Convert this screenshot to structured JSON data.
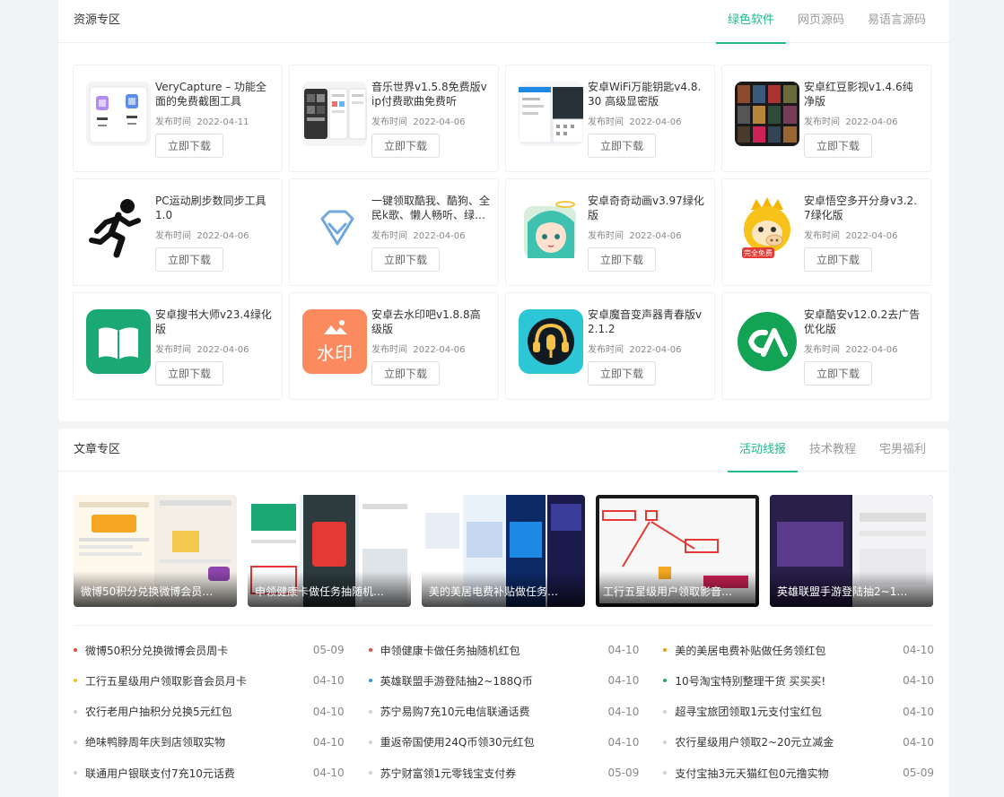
{
  "resources": {
    "title": "资源专区",
    "tabs": [
      {
        "label": "绿色软件",
        "active": true
      },
      {
        "label": "网页源码",
        "active": false
      },
      {
        "label": "易语言源码",
        "active": false
      }
    ],
    "download_label": "立即下载",
    "date_prefix": "发布时间",
    "items": [
      {
        "title": "VeryCapture – 功能全面的免费截图工具",
        "date": "2022-04-11",
        "icon": "verycapture-icon"
      },
      {
        "title": "音乐世界v1.5.8免费版vip付费歌曲免费听",
        "date": "2022-04-06",
        "icon": "music-world-icon"
      },
      {
        "title": "安卓WiFi万能钥匙v4.8.30 高级显密版",
        "date": "2022-04-06",
        "icon": "wifi-key-icon"
      },
      {
        "title": "安卓红豆影视v1.4.6纯净版",
        "date": "2022-04-06",
        "icon": "hongdou-video-icon"
      },
      {
        "title": "PC运动刷步数同步工具1.0",
        "date": "2022-04-06",
        "icon": "running-man-icon"
      },
      {
        "title": "一键领取酷我、酷狗、全民k歌、懒人畅听、绿…",
        "date": "2022-04-06",
        "icon": "diamond-icon"
      },
      {
        "title": "安卓奇奇动画v3.97绿化版",
        "date": "2022-04-06",
        "icon": "anime-girl-icon"
      },
      {
        "title": "安卓悟空多开分身v3.2.7绿化版",
        "date": "2022-04-06",
        "icon": "wukong-icon"
      },
      {
        "title": "安卓搜书大师v23.4绿化版",
        "date": "2022-04-06",
        "icon": "book-icon"
      },
      {
        "title": "安卓去水印吧v1.8.8高级版",
        "date": "2022-04-06",
        "icon": "watermark-icon"
      },
      {
        "title": "安卓魔音变声器青春版v2.1.2",
        "date": "2022-04-06",
        "icon": "voice-changer-icon"
      },
      {
        "title": "安卓酷安v12.0.2去广告优化版",
        "date": "2022-04-06",
        "icon": "coolapk-icon"
      }
    ],
    "wukong_badge": "完全免费",
    "watermark_text": "水印"
  },
  "articles": {
    "title": "文章专区",
    "tabs": [
      {
        "label": "活动线报",
        "active": true
      },
      {
        "label": "技术教程",
        "active": false
      },
      {
        "label": "宅男福利",
        "active": false
      }
    ],
    "featured": [
      {
        "title": "微博50积分兑换微博会员…"
      },
      {
        "title": "申领健康卡做任务抽随机…"
      },
      {
        "title": "美的美居电费补贴做任务…"
      },
      {
        "title": "工行五星级用户领取影音…"
      },
      {
        "title": "英雄联盟手游登陆抽2~1…"
      }
    ],
    "list": [
      {
        "text": "微博50积分兑换微博会员周卡",
        "date": "05-09",
        "dot": "#e74c3c"
      },
      {
        "text": "申领健康卡做任务抽随机红包",
        "date": "04-10",
        "dot": "#e74c3c"
      },
      {
        "text": "美的美居电费补贴做任务领红包",
        "date": "04-10",
        "dot": "#f39c12"
      },
      {
        "text": "工行五星级用户领取影音会员月卡",
        "date": "04-10",
        "dot": "#f1c40f"
      },
      {
        "text": "英雄联盟手游登陆抽2~188Q币",
        "date": "04-10",
        "dot": "#3498db"
      },
      {
        "text": "10号淘宝特别整理干货 买买买!",
        "date": "04-10",
        "dot": "#27ae60"
      },
      {
        "text": "农行老用户抽积分兑换5元红包",
        "date": "04-10",
        "dot": "#cfd3d8"
      },
      {
        "text": "苏宁易购7充10元电信联通话费",
        "date": "04-10",
        "dot": "#cfd3d8"
      },
      {
        "text": "超寻宝旅团领取1元支付宝红包",
        "date": "04-10",
        "dot": "#cfd3d8"
      },
      {
        "text": "绝味鸭脖周年庆到店领取实物",
        "date": "04-10",
        "dot": "#cfd3d8"
      },
      {
        "text": "重返帝国使用24Q币领30元红包",
        "date": "04-10",
        "dot": "#cfd3d8"
      },
      {
        "text": "农行星级用户领取2~20元立减金",
        "date": "04-10",
        "dot": "#cfd3d8"
      },
      {
        "text": "联通用户银联支付7充10元话费",
        "date": "04-10",
        "dot": "#cfd3d8"
      },
      {
        "text": "苏宁财富领1元零钱宝支付券",
        "date": "05-09",
        "dot": "#cfd3d8"
      },
      {
        "text": "支付宝抽3元天猫红包0元撸实物",
        "date": "05-09",
        "dot": "#cfd3d8"
      }
    ]
  },
  "colors": {
    "accent": "#20b98a"
  }
}
